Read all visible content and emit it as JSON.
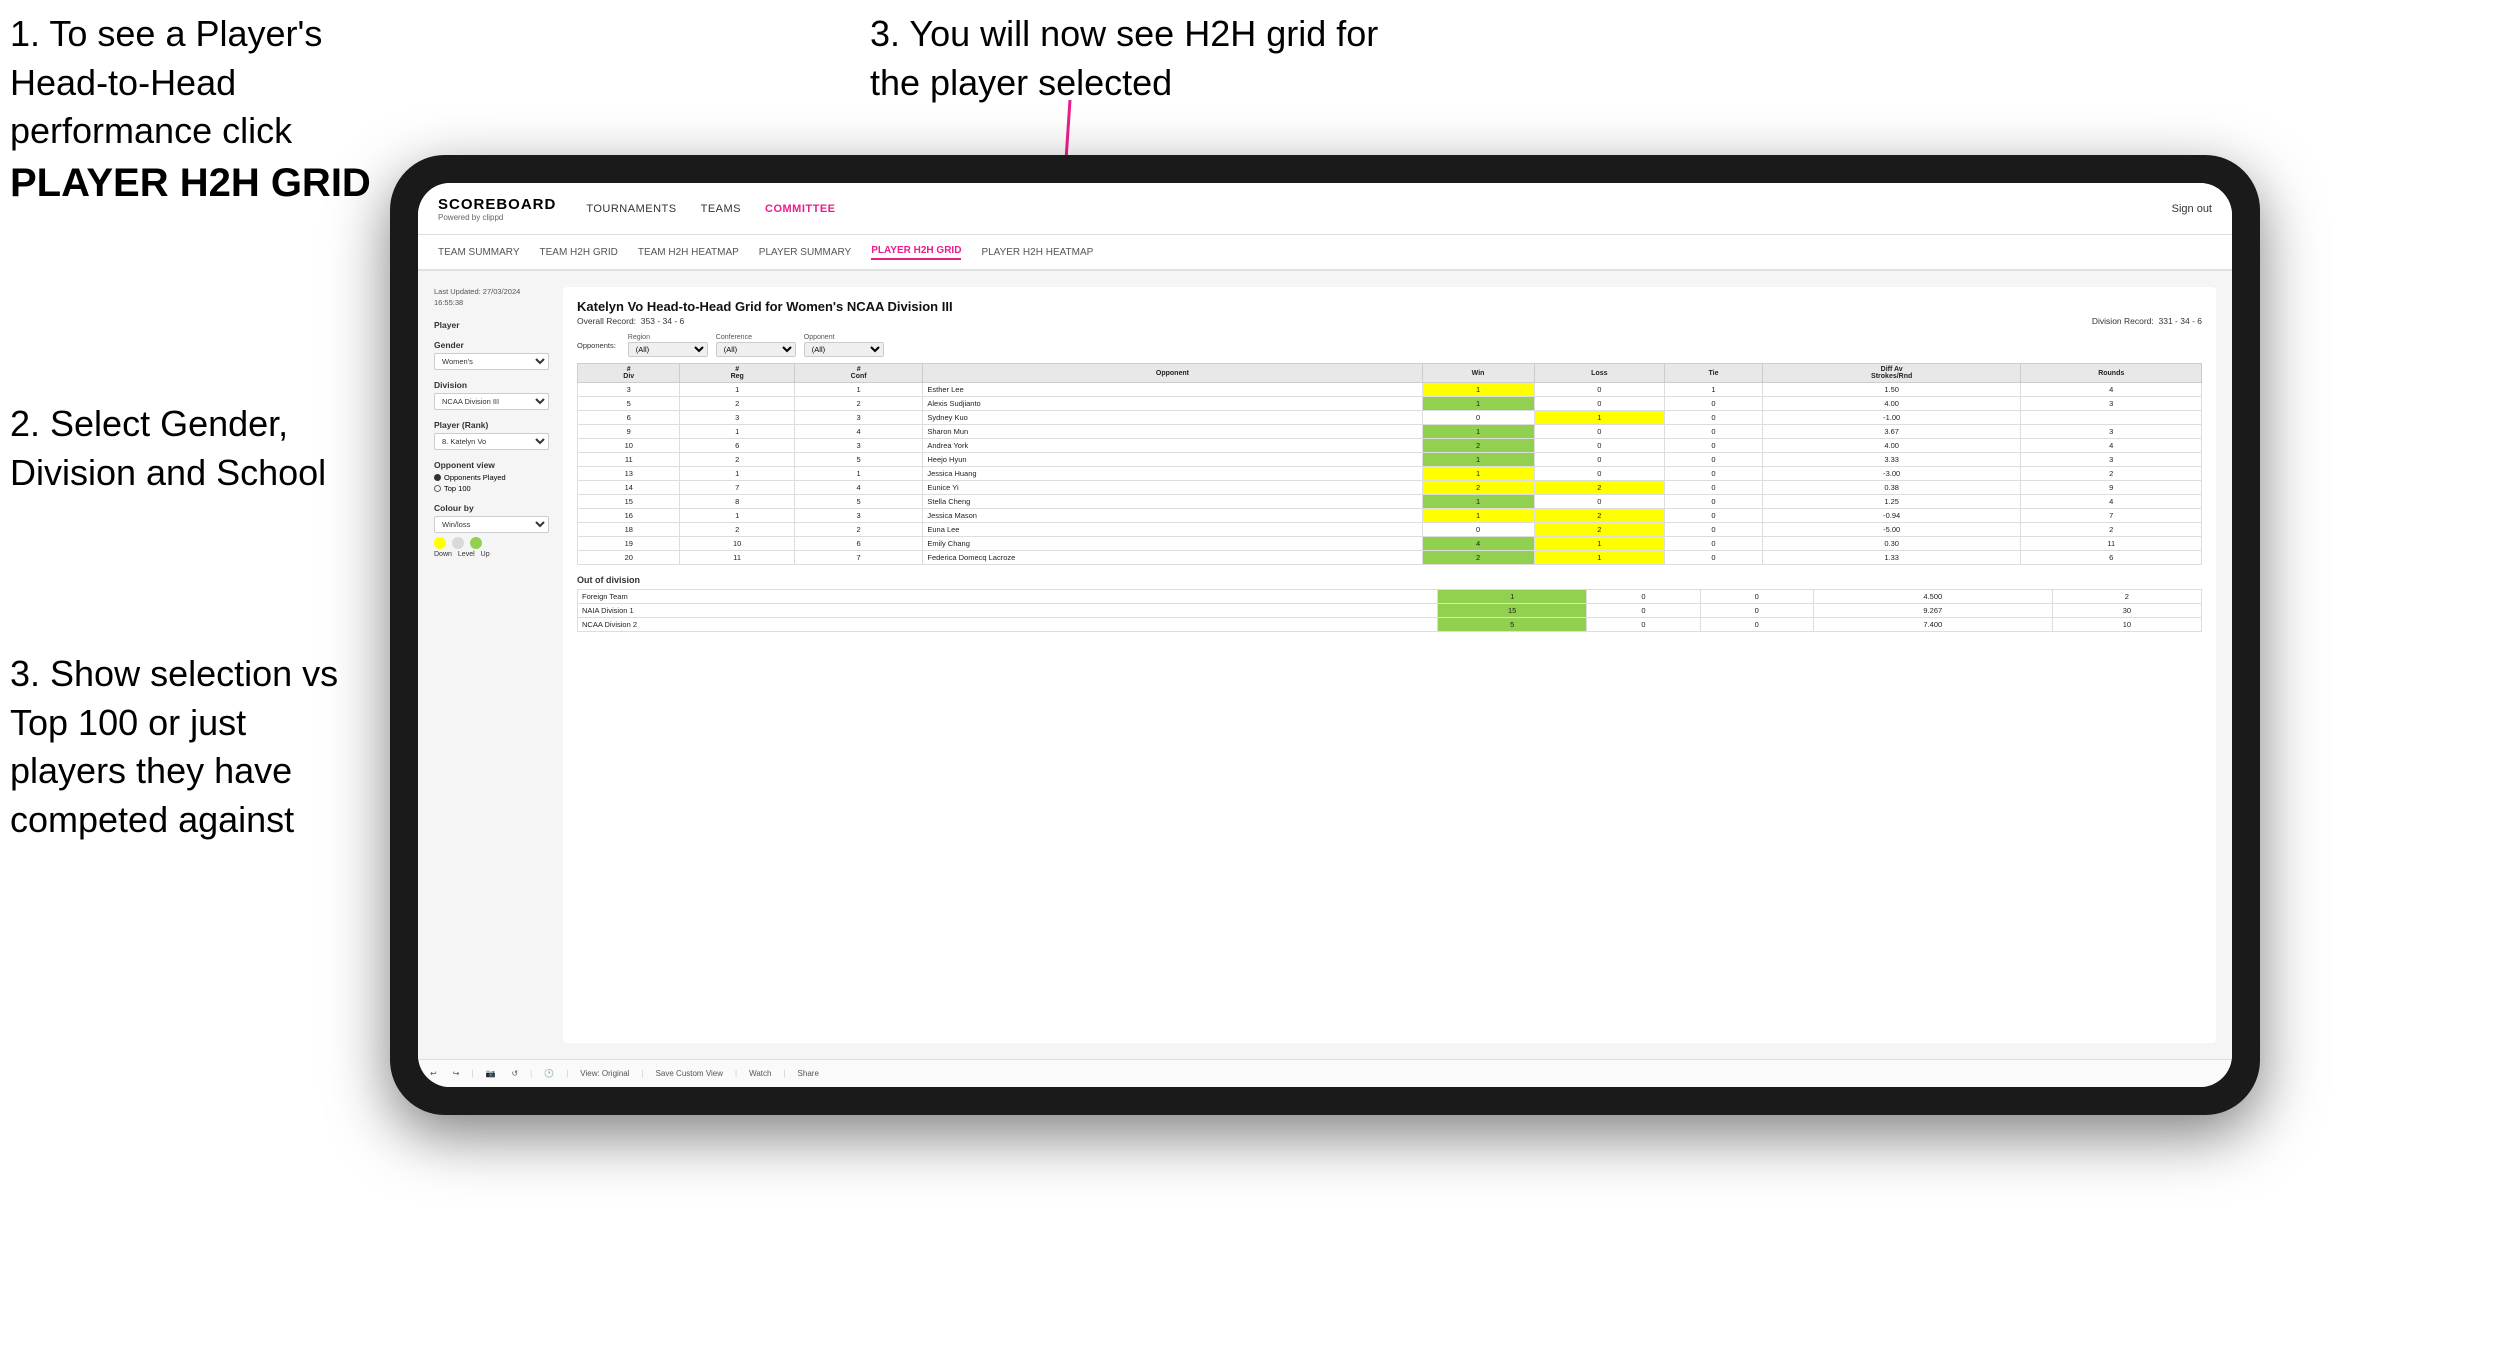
{
  "instructions": {
    "step1_title": "1. To see a Player's Head-to-Head performance click",
    "step1_bold": "PLAYER H2H GRID",
    "step3_top": "3. You will now see H2H grid for the player selected",
    "step2": "2. Select Gender, Division and School",
    "step3_bottom": "3. Show selection vs Top 100 or just players they have competed against"
  },
  "nav": {
    "logo": "SCOREBOARD",
    "logo_sub": "Powered by clippd",
    "links": [
      "TOURNAMENTS",
      "TEAMS",
      "COMMITTEE",
      ""
    ],
    "committee_active": true,
    "sign_out": "Sign out"
  },
  "subnav": {
    "items": [
      "TEAM SUMMARY",
      "TEAM H2H GRID",
      "TEAM H2H HEATMAP",
      "PLAYER SUMMARY",
      "PLAYER H2H GRID",
      "PLAYER H2H HEATMAP"
    ],
    "active": "PLAYER H2H GRID"
  },
  "left_panel": {
    "last_updated_label": "Last Updated: 27/03/2024",
    "last_updated_time": "16:55:38",
    "player_label": "Player",
    "gender_label": "Gender",
    "gender_value": "Women's",
    "division_label": "Division",
    "division_value": "NCAA Division III",
    "player_rank_label": "Player (Rank)",
    "player_rank_value": "8. Katelyn Vo",
    "opponent_view_label": "Opponent view",
    "opponent_options": [
      "Opponents Played",
      "Top 100"
    ],
    "opponent_selected": "Opponents Played",
    "colour_by_label": "Colour by",
    "colour_by_value": "Win/loss",
    "colour_labels": [
      "Down",
      "Level",
      "Up"
    ],
    "colour_colors": [
      "#ffff00",
      "#d9d9d9",
      "#92d050"
    ]
  },
  "grid": {
    "title": "Katelyn Vo Head-to-Head Grid for Women's NCAA Division III",
    "overall_record_label": "Overall Record:",
    "overall_record_value": "353 - 34 - 6",
    "division_record_label": "Division Record:",
    "division_record_value": "331 - 34 - 6",
    "filter_opponents_label": "Opponents:",
    "filter_region_label": "Region",
    "filter_conference_label": "Conference",
    "filter_opponent_label": "Opponent",
    "filter_all": "(All)",
    "col_headers": [
      "#\nDiv",
      "#\nReg",
      "#\nConf",
      "Opponent",
      "Win",
      "Loss",
      "Tie",
      "Diff Av\nStrokes/Rnd",
      "Rounds"
    ],
    "rows": [
      {
        "div": 3,
        "reg": 1,
        "conf": 1,
        "opponent": "Esther Lee",
        "win": 1,
        "loss": 0,
        "tie": 1,
        "diff": 1.5,
        "rounds": 4,
        "win_color": "yellow",
        "loss_color": "gray",
        "tie_color": "gray"
      },
      {
        "div": 5,
        "reg": 2,
        "conf": 2,
        "opponent": "Alexis Sudjianto",
        "win": 1,
        "loss": 0,
        "tie": 0,
        "diff": 4.0,
        "rounds": 3,
        "win_color": "green",
        "loss_color": "gray",
        "tie_color": "gray"
      },
      {
        "div": 6,
        "reg": 3,
        "conf": 3,
        "opponent": "Sydney Kuo",
        "win": 0,
        "loss": 1,
        "tie": 0,
        "diff": -1.0,
        "rounds": "",
        "win_color": "gray",
        "loss_color": "yellow",
        "tie_color": "gray"
      },
      {
        "div": 9,
        "reg": 1,
        "conf": 4,
        "opponent": "Sharon Mun",
        "win": 1,
        "loss": 0,
        "tie": 0,
        "diff": 3.67,
        "rounds": 3,
        "win_color": "green",
        "loss_color": "gray",
        "tie_color": "gray"
      },
      {
        "div": 10,
        "reg": 6,
        "conf": 3,
        "opponent": "Andrea York",
        "win": 2,
        "loss": 0,
        "tie": 0,
        "diff": 4.0,
        "rounds": 4,
        "win_color": "green",
        "loss_color": "gray",
        "tie_color": "gray"
      },
      {
        "div": 11,
        "reg": 2,
        "conf": 5,
        "opponent": "Heejo Hyun",
        "win": 1,
        "loss": 0,
        "tie": 0,
        "diff": 3.33,
        "rounds": 3,
        "win_color": "green",
        "loss_color": "gray",
        "tie_color": "gray"
      },
      {
        "div": 13,
        "reg": 1,
        "conf": 1,
        "opponent": "Jessica Huang",
        "win": 1,
        "loss": 0,
        "tie": 0,
        "diff": -3.0,
        "rounds": 2,
        "win_color": "yellow",
        "loss_color": "gray",
        "tie_color": "gray"
      },
      {
        "div": 14,
        "reg": 7,
        "conf": 4,
        "opponent": "Eunice Yi",
        "win": 2,
        "loss": 2,
        "tie": 0,
        "diff": 0.38,
        "rounds": 9,
        "win_color": "yellow",
        "loss_color": "yellow",
        "tie_color": "gray"
      },
      {
        "div": 15,
        "reg": 8,
        "conf": 5,
        "opponent": "Stella Cheng",
        "win": 1,
        "loss": 0,
        "tie": 0,
        "diff": 1.25,
        "rounds": 4,
        "win_color": "green",
        "loss_color": "gray",
        "tie_color": "gray"
      },
      {
        "div": 16,
        "reg": 1,
        "conf": 3,
        "opponent": "Jessica Mason",
        "win": 1,
        "loss": 2,
        "tie": 0,
        "diff": -0.94,
        "rounds": 7,
        "win_color": "yellow",
        "loss_color": "yellow",
        "tie_color": "gray"
      },
      {
        "div": 18,
        "reg": 2,
        "conf": 2,
        "opponent": "Euna Lee",
        "win": 0,
        "loss": 2,
        "tie": 0,
        "diff": -5.0,
        "rounds": 2,
        "win_color": "gray",
        "loss_color": "yellow",
        "tie_color": "gray"
      },
      {
        "div": 19,
        "reg": 10,
        "conf": 6,
        "opponent": "Emily Chang",
        "win": 4,
        "loss": 1,
        "tie": 0,
        "diff": 0.3,
        "rounds": 11,
        "win_color": "green",
        "loss_color": "yellow",
        "tie_color": "gray"
      },
      {
        "div": 20,
        "reg": 11,
        "conf": 7,
        "opponent": "Federica Domecq Lacroze",
        "win": 2,
        "loss": 1,
        "tie": 0,
        "diff": 1.33,
        "rounds": 6,
        "win_color": "green",
        "loss_color": "yellow",
        "tie_color": "gray"
      }
    ],
    "out_of_division_label": "Out of division",
    "out_of_division_rows": [
      {
        "label": "Foreign Team",
        "win": 1,
        "loss": 0,
        "tie": 0,
        "diff": 4.5,
        "rounds": 2,
        "win_color": "green"
      },
      {
        "label": "NAIA Division 1",
        "win": 15,
        "loss": 0,
        "tie": 0,
        "diff": 9.267,
        "rounds": 30,
        "win_color": "green"
      },
      {
        "label": "NCAA Division 2",
        "win": 5,
        "loss": 0,
        "tie": 0,
        "diff": 7.4,
        "rounds": 10,
        "win_color": "green"
      }
    ]
  },
  "toolbar": {
    "view_original": "View: Original",
    "save_custom": "Save Custom View",
    "watch": "Watch",
    "share": "Share"
  }
}
